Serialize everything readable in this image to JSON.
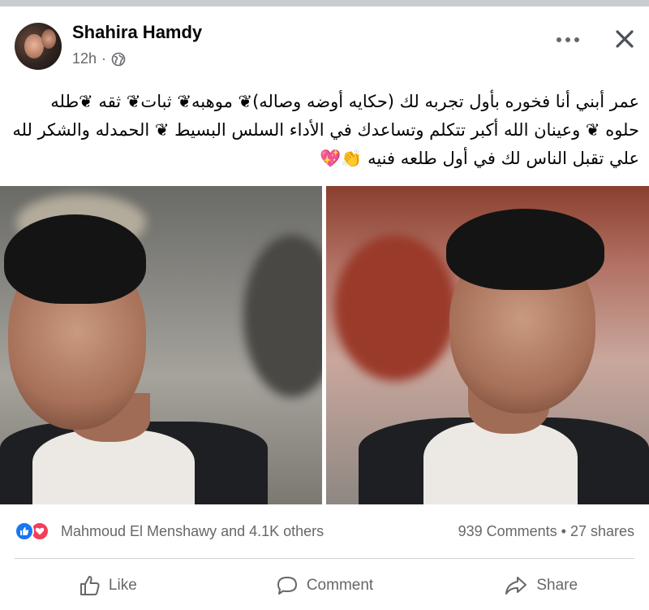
{
  "post": {
    "author": "Shahira Hamdy",
    "time": "12h",
    "separator": "·",
    "privacy_icon": "globe-icon",
    "text_lines": [
      "عمر أبني أنا فخوره بأول تجربه لك  (حكايه أوضه وصاله)❦ موهبه❦ ثبات❦ ثقه ❦طله",
      "حلوه ❦ وعينان الله أكبر تتكلم وتساعدك في الأداء السلس البسيط ❦   الحمدله والشكر لله",
      "علي تقبل الناس لك في أول طلعه فنيه 👏💖"
    ]
  },
  "header": {
    "more_icon": "more-horizontal-icon",
    "close_icon": "close-icon"
  },
  "reactions": {
    "icons": [
      "like-icon",
      "love-icon"
    ],
    "summary": "Mahmoud El Menshawy and 4.1K others",
    "comments_shares": "939 Comments • 27 shares"
  },
  "actions": {
    "like": "Like",
    "comment": "Comment",
    "share": "Share"
  },
  "colors": {
    "like_blue": "#1877f2",
    "love_red": "#f33e58",
    "secondary_text": "#65676b",
    "divider": "#ced0d4"
  }
}
